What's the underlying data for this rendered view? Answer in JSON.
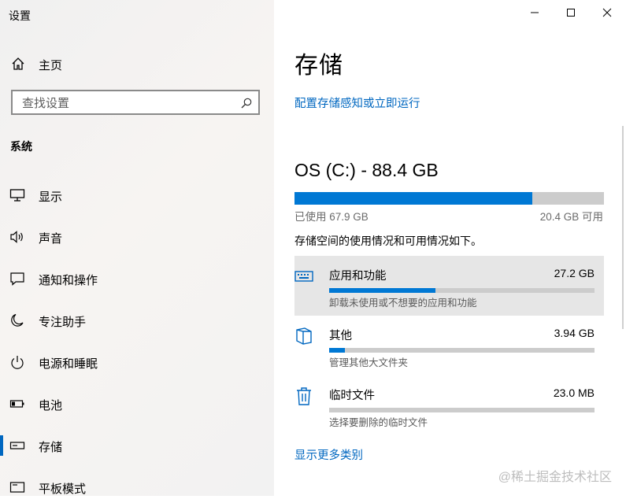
{
  "sidebar": {
    "app_title": "设置",
    "home_label": "主页",
    "search_placeholder": "查找设置",
    "section_heading": "系统",
    "items": [
      {
        "label": "显示",
        "icon": "monitor-icon"
      },
      {
        "label": "声音",
        "icon": "speaker-icon"
      },
      {
        "label": "通知和操作",
        "icon": "notification-icon"
      },
      {
        "label": "专注助手",
        "icon": "moon-icon"
      },
      {
        "label": "电源和睡眠",
        "icon": "power-icon"
      },
      {
        "label": "电池",
        "icon": "battery-icon"
      },
      {
        "label": "存储",
        "icon": "storage-icon",
        "active": true
      },
      {
        "label": "平板模式",
        "icon": "tablet-icon"
      }
    ]
  },
  "window": {
    "minimize": "minimize-icon",
    "maximize": "maximize-icon",
    "close": "close-icon"
  },
  "main": {
    "title": "存储",
    "config_link": "配置存储感知或立即运行",
    "drive": {
      "title": "OS (C:) - 88.4 GB",
      "used_label": "已使用 67.9 GB",
      "free_label": "20.4 GB 可用",
      "used_fraction": 0.768
    },
    "description": "存储空间的使用情况和可用情况如下。",
    "categories": [
      {
        "name": "应用和功能",
        "size": "27.2 GB",
        "subtitle": "卸载未使用或不想要的应用和功能",
        "fraction": 0.4,
        "icon": "keyboard-icon"
      },
      {
        "name": "其他",
        "size": "3.94 GB",
        "subtitle": "管理其他大文件夹",
        "fraction": 0.06,
        "icon": "folder-icon"
      },
      {
        "name": "临时文件",
        "size": "23.0 MB",
        "subtitle": "选择要删除的临时文件",
        "fraction": 0.0,
        "icon": "trash-icon"
      }
    ],
    "more_link": "显示更多类别"
  },
  "watermark": "@稀土掘金技术社区",
  "colors": {
    "accent": "#0067c0",
    "bar_fill": "#0078d4",
    "bar_track": "#cccccc"
  }
}
